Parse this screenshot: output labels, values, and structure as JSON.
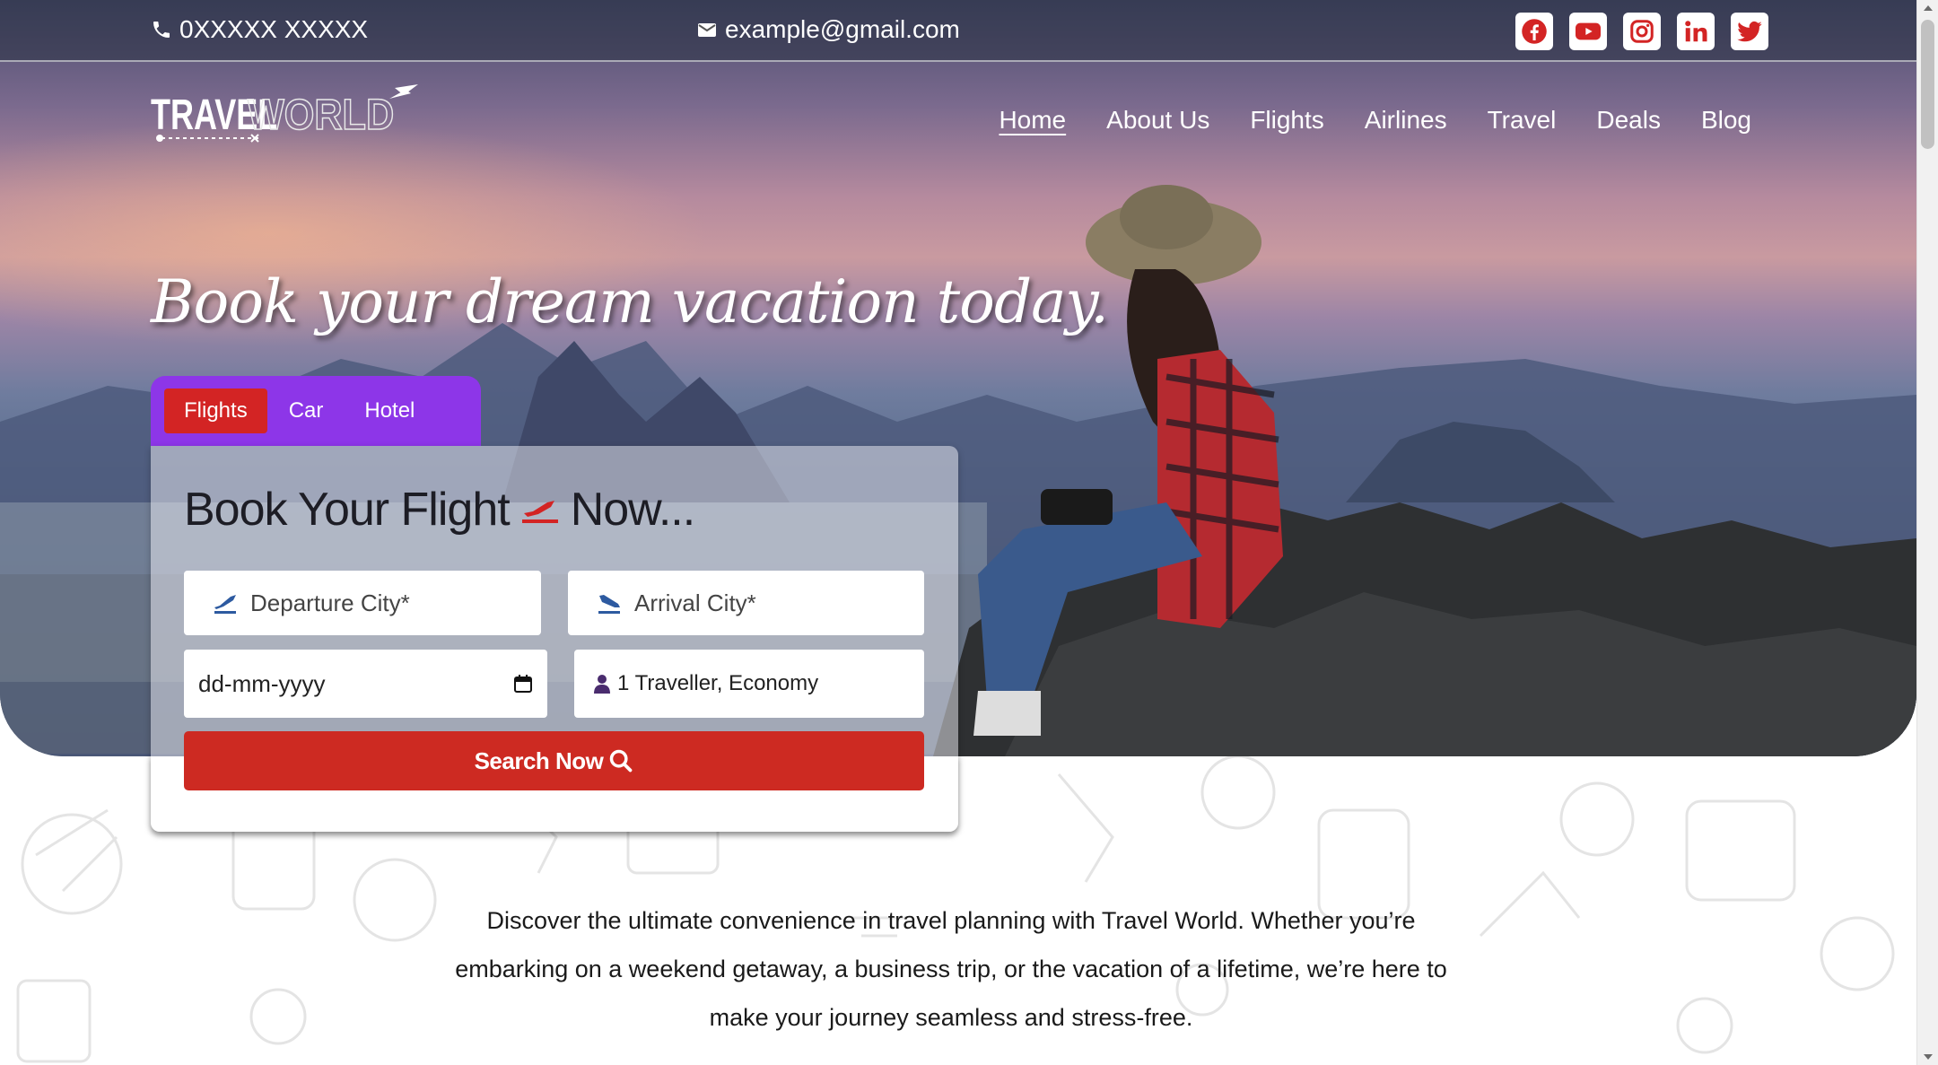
{
  "topbar": {
    "phone": "0XXXXX XXXXX",
    "email": "example@gmail.com",
    "social": [
      {
        "icon": "facebook-icon",
        "color": "#d32424"
      },
      {
        "icon": "youtube-icon",
        "color": "#d32424"
      },
      {
        "icon": "instagram-icon",
        "color": "#d32424"
      },
      {
        "icon": "linkedin-icon",
        "color": "#d32424"
      },
      {
        "icon": "twitter-icon",
        "color": "#d32424"
      }
    ]
  },
  "logo": {
    "text_primary": "TRAVEL",
    "text_secondary": "WORLD"
  },
  "nav": {
    "items": [
      "Home",
      "About Us",
      "Flights",
      "Airlines",
      "Travel",
      "Deals",
      "Blog"
    ],
    "active": "Home"
  },
  "hero": {
    "headline": "Book your dream vacation today."
  },
  "booking": {
    "tabs": [
      "Flights",
      "Car",
      "Hotel"
    ],
    "active_tab": "Flights",
    "title_part1": "Book Your Flight",
    "title_part2": "Now...",
    "departure_placeholder": "Departure City*",
    "arrival_placeholder": "Arrival City*",
    "date_placeholder": "dd-mm-yyyy",
    "travellers": "1 Traveller, Economy",
    "search_label": "Search Now"
  },
  "intro": {
    "text": "Discover the ultimate convenience in travel planning with Travel World. Whether you’re embarking on a weekend getaway, a business trip, or the vacation of a lifetime, we’re here to make your journey seamless and stress-free."
  },
  "colors": {
    "accent_red": "#cd2a22",
    "tab_purple": "#8d36e8"
  }
}
